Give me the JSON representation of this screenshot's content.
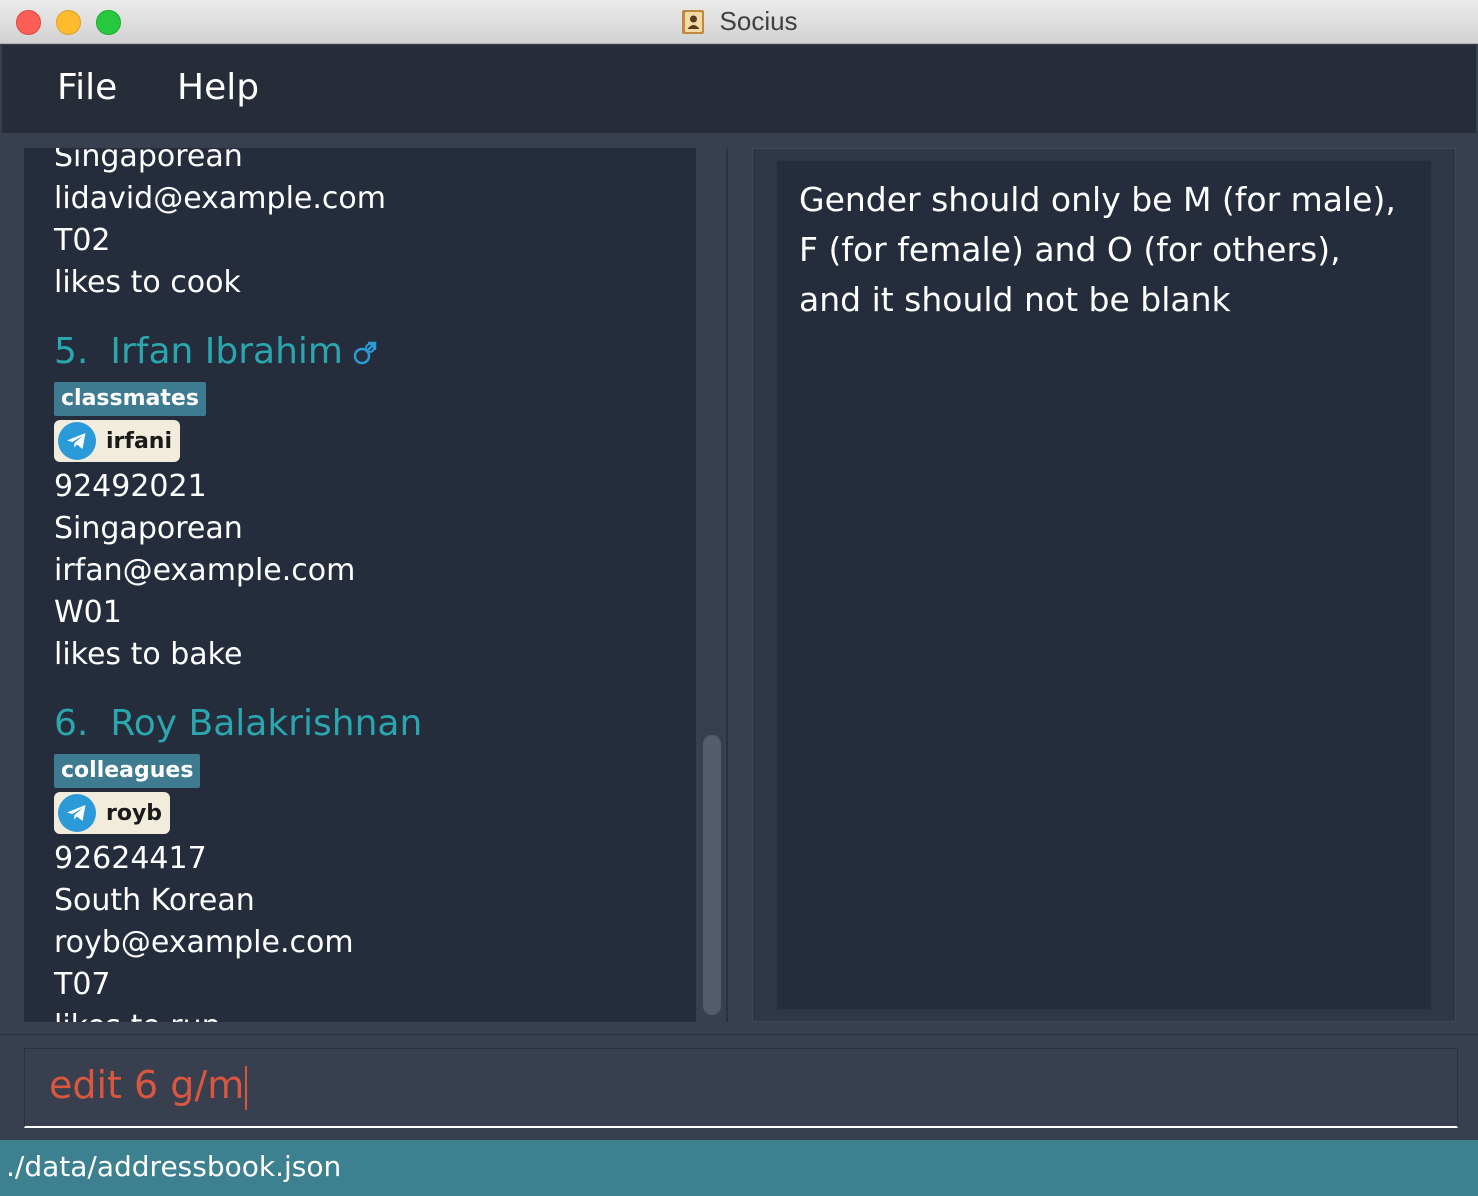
{
  "window": {
    "title": "Socius"
  },
  "menu": {
    "file": "File",
    "help": "Help"
  },
  "partial_card": {
    "nationality": "Singaporean",
    "email": "lidavid@example.com",
    "tutorial_group": "T02",
    "remark": "likes to cook"
  },
  "cards": [
    {
      "index": "5.",
      "name": "Irfan Ibrahim",
      "gender_icon": "male-symbol-icon",
      "tag": "classmates",
      "telegram": "irfani",
      "phone": "92492021",
      "nationality": "Singaporean",
      "email": "irfan@example.com",
      "tutorial_group": "W01",
      "remark": "likes to bake"
    },
    {
      "index": "6.",
      "name": "Roy Balakrishnan",
      "tag": "colleagues",
      "telegram": "royb",
      "phone": "92624417",
      "nationality": "South Korean",
      "email": "royb@example.com",
      "tutorial_group": "T07",
      "remark": "likes to run"
    }
  ],
  "result": {
    "message": "Gender should only be M (for male), F (for female) and O (for others), and it should not be blank"
  },
  "command": {
    "value": "edit 6 g/m"
  },
  "status": {
    "file_path": "./data/addressbook.json"
  },
  "colors": {
    "name_accent": "#2aa6ae",
    "tag_bg": "#3e7b91",
    "command_error": "#d9573e",
    "status_bar": "#3d8090",
    "telegram_blue": "#2a9ad8"
  }
}
